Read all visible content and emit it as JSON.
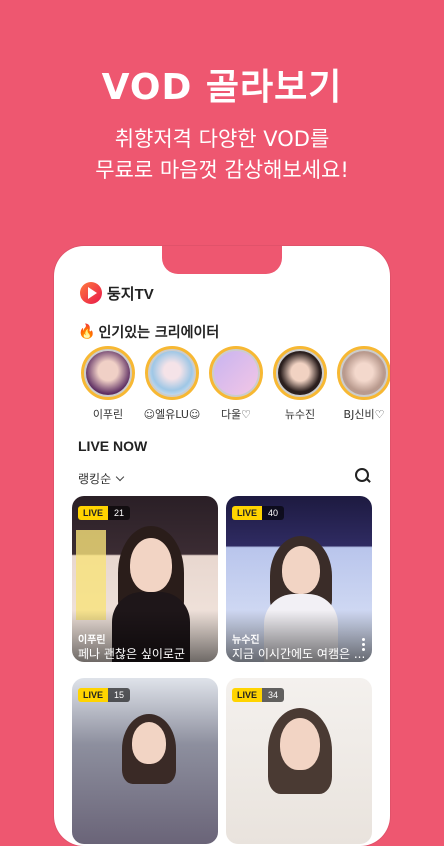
{
  "promo": {
    "title": "VOD 골라보기",
    "subtitle_line1": "취향저격 다양한 VOD를",
    "subtitle_line2": "무료로 마음껏 감상해보세요!"
  },
  "app": {
    "logo_text": "둥지TV"
  },
  "popular": {
    "title": "인기있는 크리에이터",
    "creators": [
      {
        "name": "이푸린"
      },
      {
        "name": "☺엘유LU☺"
      },
      {
        "name": "다울♡"
      },
      {
        "name": "뉴수진"
      },
      {
        "name": "BJ신비♡"
      }
    ]
  },
  "live": {
    "title": "LIVE NOW",
    "sort_label": "랭킹순",
    "cards": [
      {
        "badge": "LIVE",
        "viewers": "21",
        "name": "이푸린",
        "caption": "페나 괜찮은 싶이로군"
      },
      {
        "badge": "LIVE",
        "viewers": "40",
        "name": "뉴수진",
        "caption": "지금 이시간에도 여캠은 ..."
      },
      {
        "badge": "LIVE",
        "viewers": "15",
        "name": "",
        "caption": ""
      },
      {
        "badge": "LIVE",
        "viewers": "34",
        "name": "",
        "caption": ""
      }
    ]
  },
  "colors": {
    "background": "#ee5770",
    "ring": "#f7b833",
    "live_badge": "#ffd400"
  }
}
